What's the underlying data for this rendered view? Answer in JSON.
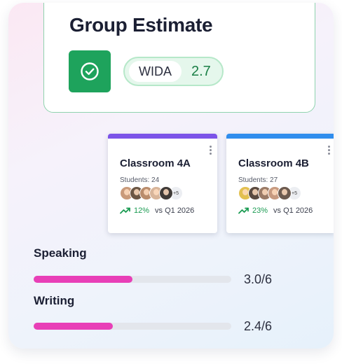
{
  "estimate": {
    "title": "Group Estimate",
    "badge_icon": "check-circle-icon",
    "badge_color": "#1ea35c",
    "metric_label": "WIDA",
    "metric_value": "2.7"
  },
  "classrooms": [
    {
      "name": "Classroom 4A",
      "accent": "#7b53e8",
      "students_text": "Students: 24",
      "more_text": "+5",
      "avatar_colors": [
        "#c99a7a",
        "#6b5644",
        "#b98c6c",
        "#d8b59a",
        "#3f3a37"
      ],
      "trend_percent": "12%",
      "trend_ref": "vs Q1 2026"
    },
    {
      "name": "Classroom 4B",
      "accent": "#2f8ded",
      "students_text": "Students: 27",
      "more_text": "+5",
      "avatar_colors": [
        "#e2c050",
        "#5a4a40",
        "#9a7a66",
        "#c79a80",
        "#6c5a4f"
      ],
      "trend_percent": "23%",
      "trend_ref": "vs Q1 2026"
    }
  ],
  "skills": [
    {
      "label": "Speaking",
      "score_text": "3.0/6",
      "value": 3.0,
      "max": 6
    },
    {
      "label": "Writing",
      "score_text": "2.4/6",
      "value": 2.4,
      "max": 6
    }
  ],
  "colors": {
    "progress_fill": "#e83fb7",
    "trend_green": "#1a9b52"
  }
}
